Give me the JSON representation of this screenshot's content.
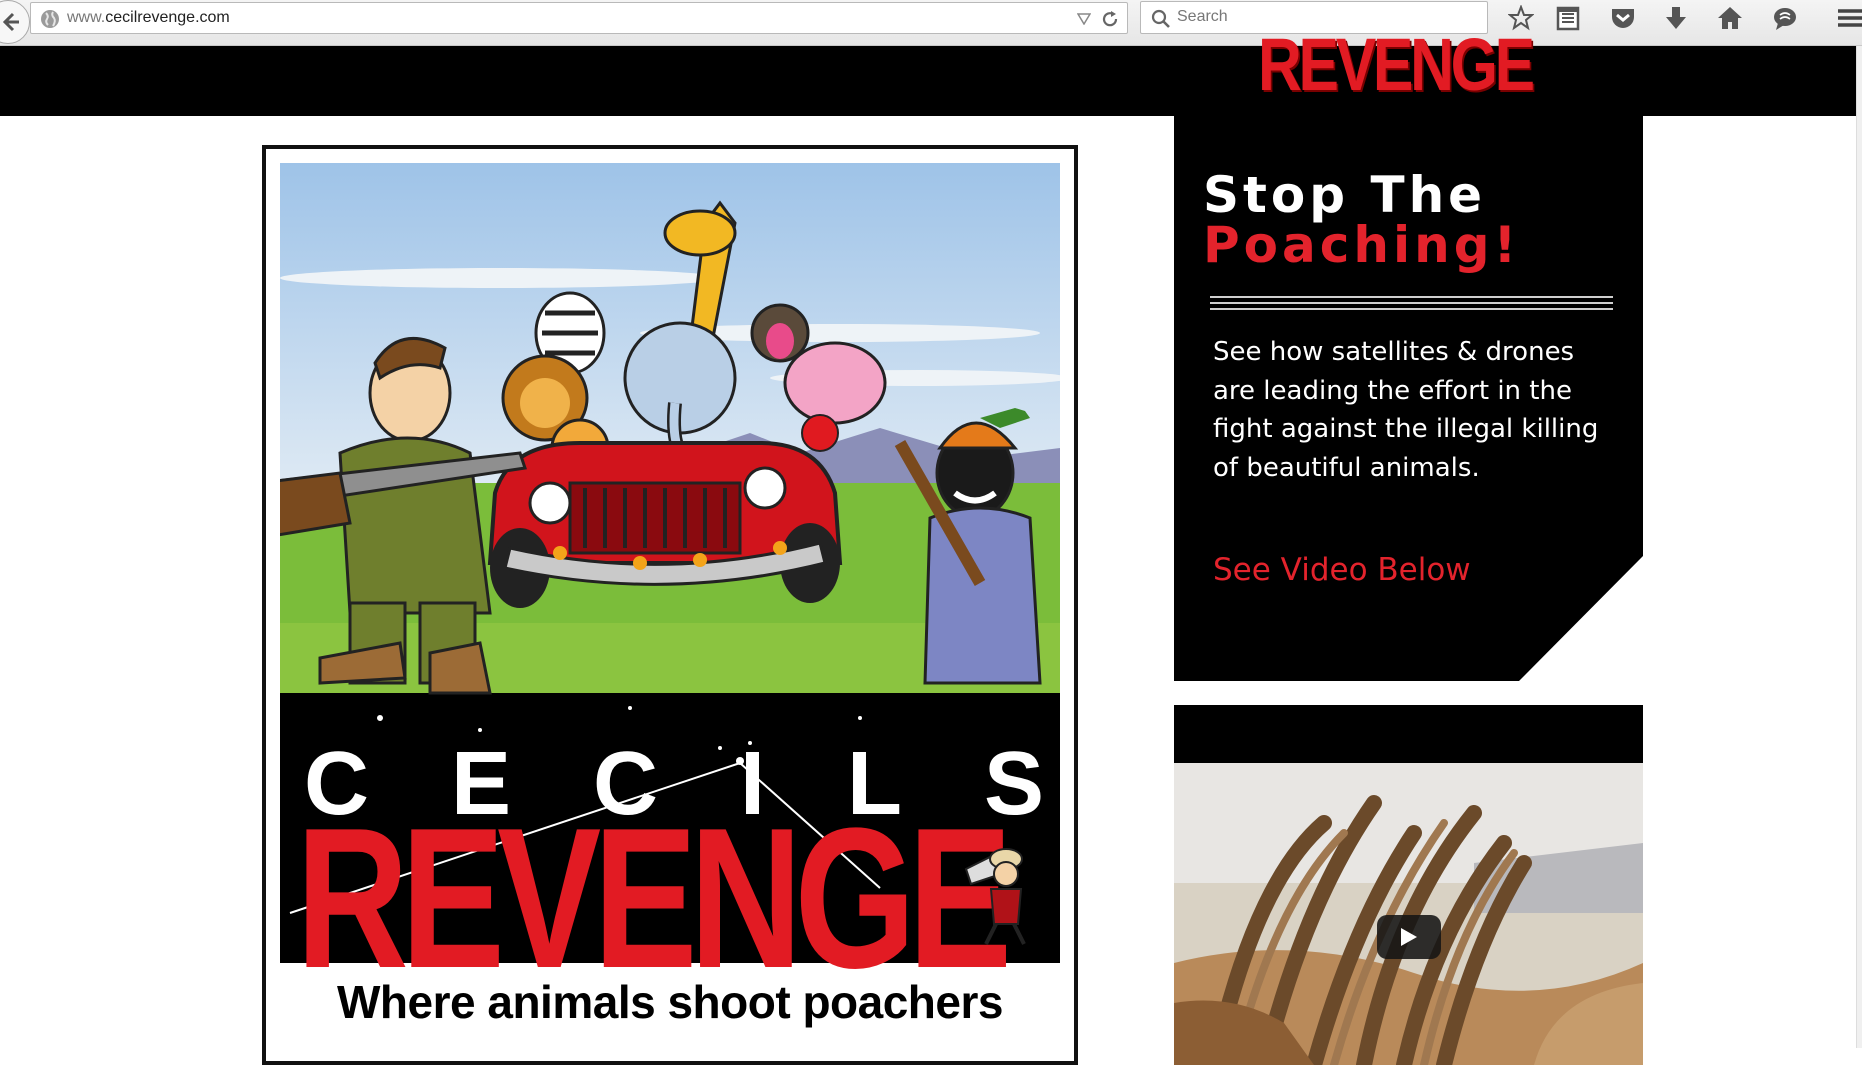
{
  "browser": {
    "url_prefix": "www.",
    "url_domain": "cecilrevenge.com",
    "search_placeholder": "Search",
    "icons": [
      "back-arrow-icon",
      "globe-icon",
      "dropdown-icon",
      "reload-icon",
      "search-icon",
      "bookmark-star-icon",
      "reading-list-icon",
      "pocket-icon",
      "download-icon",
      "home-icon",
      "chat-icon",
      "menu-icon"
    ]
  },
  "header": {
    "logo_text": "REVENGE"
  },
  "poster": {
    "word_cecils": [
      "C",
      "E",
      "C",
      "I",
      "L",
      "S"
    ],
    "word_revenge": "REVENGE",
    "tagline": "Where animals shoot poachers"
  },
  "promo": {
    "title_line1": "Stop The",
    "title_line2": "Poaching!",
    "body": "See how satellites & drones are leading the effort in the fight against the illegal killing of beautiful animals.",
    "link": "See Video Below"
  },
  "video": {
    "play_icon": "play-icon"
  },
  "colors": {
    "brand_red": "#e21b23",
    "header_black": "#000000"
  }
}
